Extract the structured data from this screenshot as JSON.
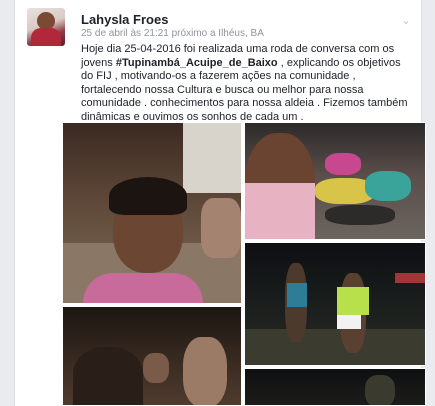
{
  "post": {
    "author": "Lahysla Froes",
    "meta": "25 de abril às 21:21 próximo a Ilhéus, BA",
    "text_before": "Hoje dia 25-04-2016 foi realizada uma roda de conversa com os jovens ",
    "hashtag": "#Tupinambá_Acuipe_de_Baixo",
    "text_after": " , explicando os objetivos do FIJ , motivando-os a fazerem ações na comunidade , fortalecendo nossa Cultura e busca ou melhor para nossa comunidade .  conhecimentos para nossa aldeia . Fizemos também dinâmicas e ouvimos os sonhos de cada um ."
  },
  "icons": {
    "menu": "chevron-down-icon",
    "avatar": "profile-photo"
  },
  "colors": {
    "background": "#e9ebee",
    "card": "#ffffff",
    "text": "#1d2129",
    "meta": "#90949c"
  }
}
